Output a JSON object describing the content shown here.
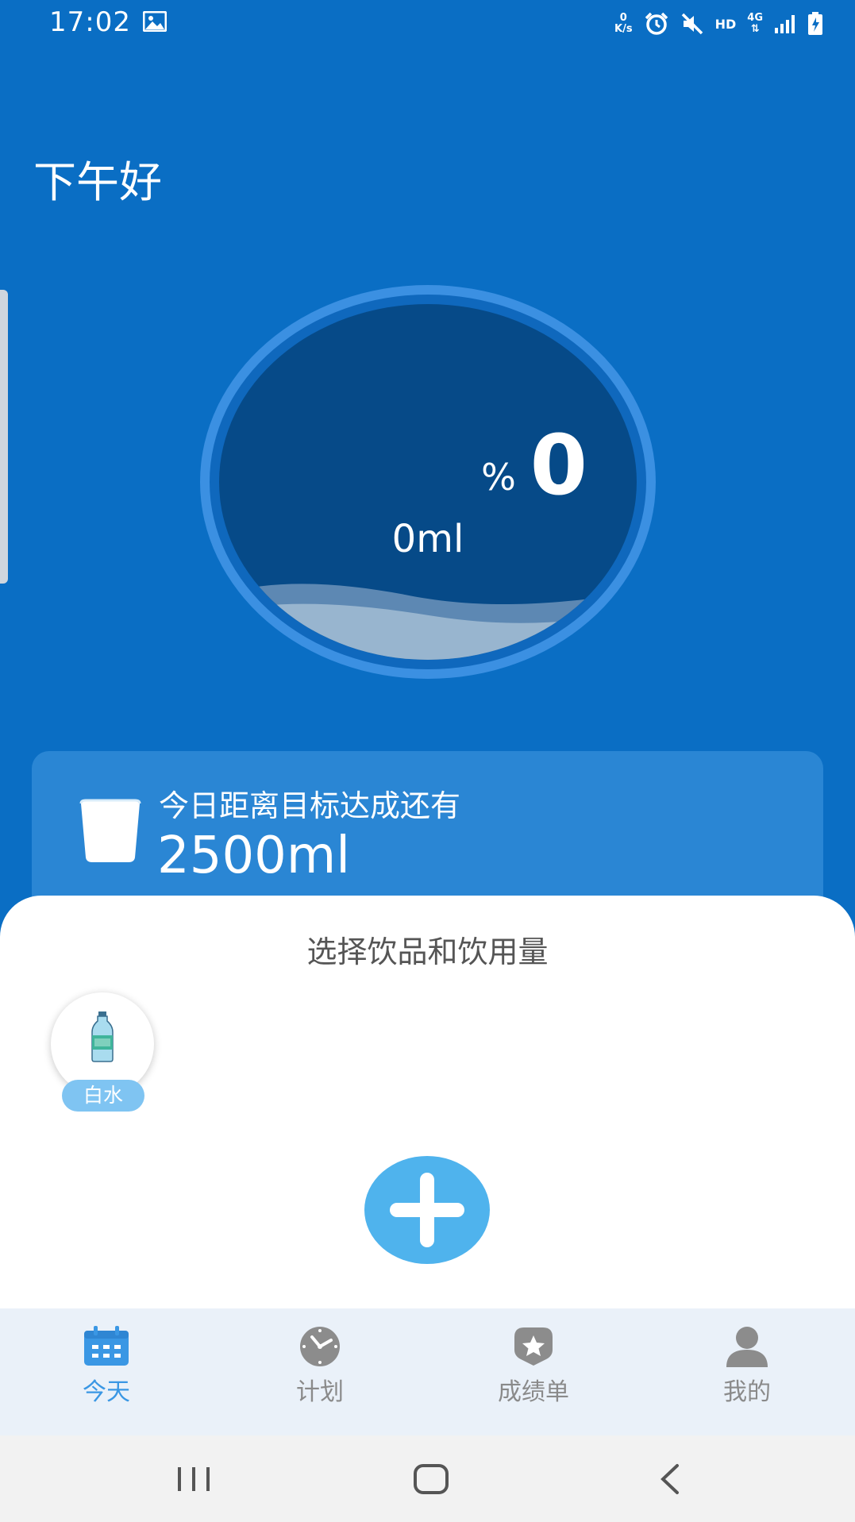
{
  "status_bar": {
    "time": "17:02",
    "speed_value": "0",
    "speed_unit": "K/s",
    "hd": "HD",
    "network": "4G",
    "icons": [
      "gallery-icon",
      "alarm-icon",
      "mute-icon",
      "signal-icon",
      "battery-charging-icon"
    ]
  },
  "greeting": "下午好",
  "gauge": {
    "percent_value": "0",
    "percent_sign": "%",
    "amount": "0ml",
    "fill_fraction": 0
  },
  "goal": {
    "label": "今日距离目标达成还有",
    "value": "2500ml",
    "icon": "cup-icon"
  },
  "drink_sheet": {
    "title": "选择饮品和饮用量",
    "drinks": [
      {
        "label": "白水",
        "icon": "water-bottle-icon"
      }
    ],
    "add_icon": "plus-icon"
  },
  "bottom_nav": {
    "items": [
      {
        "label": "今天",
        "icon": "calendar-icon",
        "active": true
      },
      {
        "label": "计划",
        "icon": "clock-icon",
        "active": false
      },
      {
        "label": "成绩单",
        "icon": "badge-star-icon",
        "active": false
      },
      {
        "label": "我的",
        "icon": "person-icon",
        "active": false
      }
    ]
  },
  "system_nav": {
    "icons": [
      "recents-icon",
      "home-icon",
      "back-icon"
    ]
  },
  "colors": {
    "primary_blue": "#0a6ec4",
    "card_blue": "#2a86d4",
    "accent_blue": "#4fb3ed",
    "active_tab": "#3a97e4",
    "inactive_tab": "#8a8a8a"
  }
}
